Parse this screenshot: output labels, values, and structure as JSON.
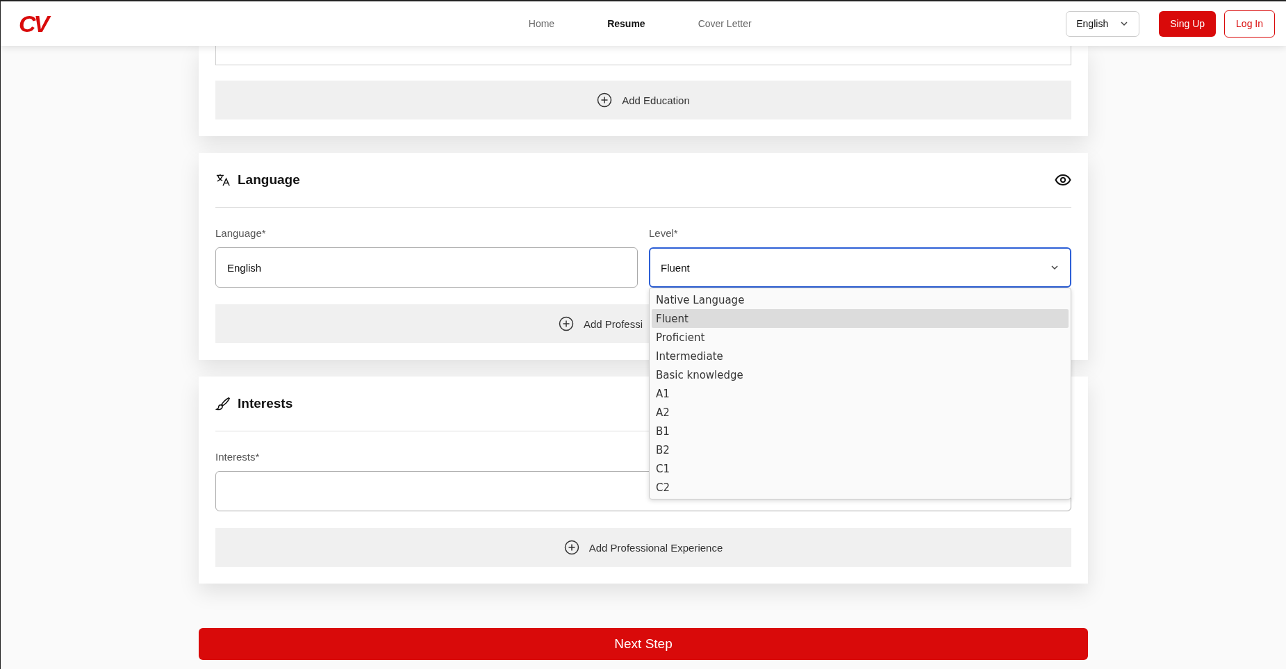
{
  "header": {
    "logo": "CV",
    "nav": [
      {
        "label": "Home",
        "selected": false
      },
      {
        "label": "Resume",
        "selected": true
      },
      {
        "label": "Cover Letter",
        "selected": false
      }
    ],
    "language_select": {
      "value": "English"
    },
    "sign_up_button": "Sing Up",
    "log_in_button": "Log In"
  },
  "education_section": {
    "add_button": "Add Education"
  },
  "language_section": {
    "title": "Language",
    "language_field": {
      "label": "Language*",
      "value": "English"
    },
    "level_field": {
      "label": "Level*",
      "value": "Fluent",
      "expanded": true
    },
    "level_options": [
      {
        "label": "Native Language",
        "selected": false
      },
      {
        "label": "Fluent",
        "selected": true
      },
      {
        "label": "Proficient",
        "selected": false
      },
      {
        "label": "Intermediate",
        "selected": false
      },
      {
        "label": "Basic knowledge",
        "selected": false
      },
      {
        "label": "A1",
        "selected": false
      },
      {
        "label": "A2",
        "selected": false
      },
      {
        "label": "B1",
        "selected": false
      },
      {
        "label": "B2",
        "selected": false
      },
      {
        "label": "C1",
        "selected": false
      },
      {
        "label": "C2",
        "selected": false
      }
    ],
    "add_button": "Add Professi"
  },
  "interests_section": {
    "title": "Interests",
    "interests_field": {
      "label": "Interests*"
    },
    "add_button": "Add Professional Experience"
  },
  "next_button": "Next Step"
}
